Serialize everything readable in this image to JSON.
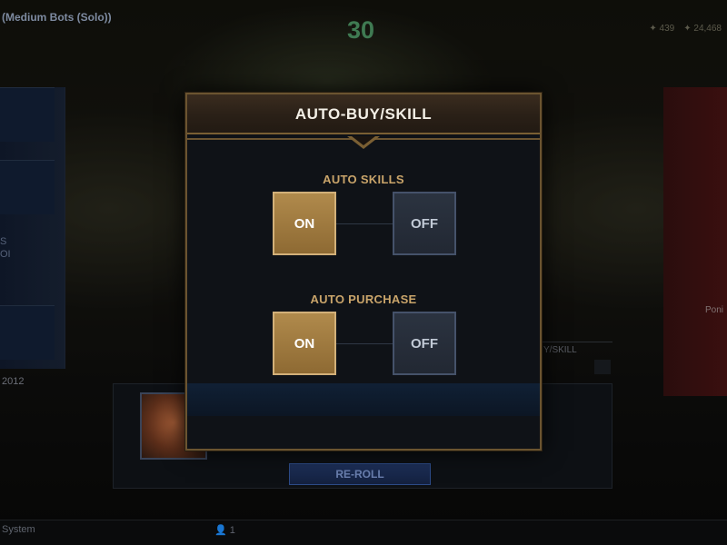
{
  "background": {
    "mode_title": "(Medium Bots (Solo))",
    "timer": "30",
    "currency_a": "439",
    "currency_b": "24,468",
    "left_text_a": "S",
    "left_text_b": "OI",
    "year_text": "2012",
    "right_name": "Poni",
    "bg_button_label": "Y/SKILL",
    "reroll_label": "RE-ROLL",
    "system_tab": "System",
    "user_count": "1"
  },
  "modal": {
    "title": "AUTO-BUY/SKILL",
    "auto_skills": {
      "label": "AUTO SKILLS",
      "on_label": "ON",
      "off_label": "OFF",
      "selected": "ON"
    },
    "auto_purchase": {
      "label": "AUTO PURCHASE",
      "on_label": "ON",
      "off_label": "OFF",
      "selected": "ON"
    }
  },
  "colors": {
    "accent_gold": "#c9a46a",
    "on_fill": "#a07c42",
    "off_fill": "#262d38",
    "timer_green": "#3f7a52"
  }
}
